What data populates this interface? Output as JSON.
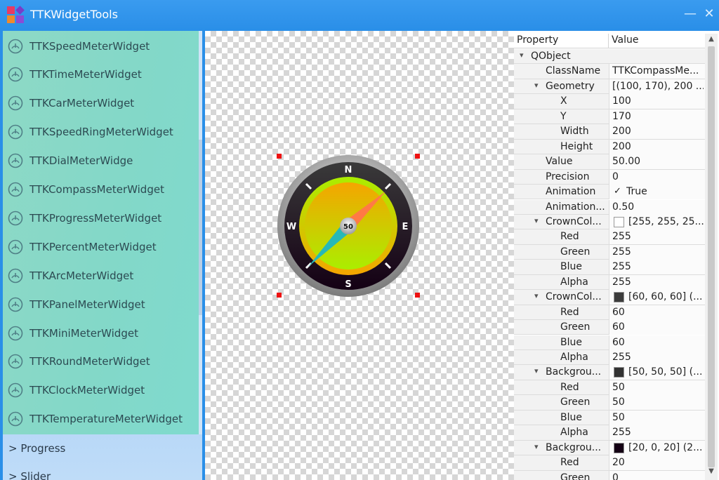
{
  "window": {
    "title": "TTKWidgetTools",
    "minimize": "—",
    "close": "✕"
  },
  "sidebar": {
    "items": [
      "TTKSpeedMeterWidget",
      "TTKTimeMeterWidget",
      "TTKCarMeterWidget",
      "TTKSpeedRingMeterWidget",
      "TTKDialMeterWidge",
      "TTKCompassMeterWidget",
      "TTKProgressMeterWidget",
      "TTKPercentMeterWidget",
      "TTKArcMeterWidget",
      "TTKPanelMeterWidget",
      "TTKMiniMeterWidget",
      "TTKRoundMeterWidget",
      "TTKClockMeterWidget",
      "TTKTemperatureMeterWidget"
    ],
    "item_icon": "gauge-icon",
    "groups": [
      "> Progress",
      "> Slider"
    ]
  },
  "canvas": {
    "compass": {
      "value_label": "50",
      "directions": {
        "north": "N",
        "south": "S",
        "east": "E",
        "west": "W"
      },
      "crown_color": "#ffffff",
      "crown_dark_color": "#3c3c3c",
      "background_color": "#323232",
      "bezel_color": "#140014",
      "face_colors": [
        "#f5a500",
        "#aaee00"
      ],
      "needle_colors": [
        "#ff7a45",
        "#26b8b8"
      ]
    }
  },
  "properties": {
    "header": {
      "property": "Property",
      "value": "Value"
    },
    "rows": [
      {
        "name": "QObject",
        "value": "",
        "level": 0,
        "expand": "▾"
      },
      {
        "name": "ClassName",
        "value": "TTKCompassMe...",
        "level": 1
      },
      {
        "name": "Geometry",
        "value": "[(100, 170), 200 ...",
        "level": 1,
        "expand": "▾"
      },
      {
        "name": "X",
        "value": "100",
        "level": 2
      },
      {
        "name": "Y",
        "value": "170",
        "level": 2
      },
      {
        "name": "Width",
        "value": "200",
        "level": 2
      },
      {
        "name": "Height",
        "value": "200",
        "level": 2
      },
      {
        "name": "Value",
        "value": "50.00",
        "level": 1
      },
      {
        "name": "Precision",
        "value": "0",
        "level": 1
      },
      {
        "name": "Animation",
        "value": "True",
        "level": 1,
        "check": "✓"
      },
      {
        "name": "Animation...",
        "value": "0.50",
        "level": 1
      },
      {
        "name": "CrownCol...",
        "value": "[255, 255, 25...",
        "level": 1,
        "expand": "▾",
        "swatch": "#ffffff"
      },
      {
        "name": "Red",
        "value": "255",
        "level": 2
      },
      {
        "name": "Green",
        "value": "255",
        "level": 2
      },
      {
        "name": "Blue",
        "value": "255",
        "level": 2
      },
      {
        "name": "Alpha",
        "value": "255",
        "level": 2
      },
      {
        "name": "CrownCol...",
        "value": "[60, 60, 60] (...",
        "level": 1,
        "expand": "▾",
        "swatch": "#3c3c3c"
      },
      {
        "name": "Red",
        "value": "60",
        "level": 2
      },
      {
        "name": "Green",
        "value": "60",
        "level": 2
      },
      {
        "name": "Blue",
        "value": "60",
        "level": 2
      },
      {
        "name": "Alpha",
        "value": "255",
        "level": 2
      },
      {
        "name": "Backgrou...",
        "value": "[50, 50, 50] (...",
        "level": 1,
        "expand": "▾",
        "swatch": "#323232"
      },
      {
        "name": "Red",
        "value": "50",
        "level": 2
      },
      {
        "name": "Green",
        "value": "50",
        "level": 2
      },
      {
        "name": "Blue",
        "value": "50",
        "level": 2
      },
      {
        "name": "Alpha",
        "value": "255",
        "level": 2
      },
      {
        "name": "Backgrou...",
        "value": "[20, 0, 20] (2...",
        "level": 1,
        "expand": "▾",
        "swatch": "#140014"
      },
      {
        "name": "Red",
        "value": "20",
        "level": 2
      },
      {
        "name": "Green",
        "value": "0",
        "level": 2
      }
    ],
    "scroll_up": "▲",
    "scroll_down": "▼"
  },
  "colors": {
    "titlebar": "#2a8fe8",
    "list_bg": "#83d8c8",
    "handle": "#ee1111"
  }
}
